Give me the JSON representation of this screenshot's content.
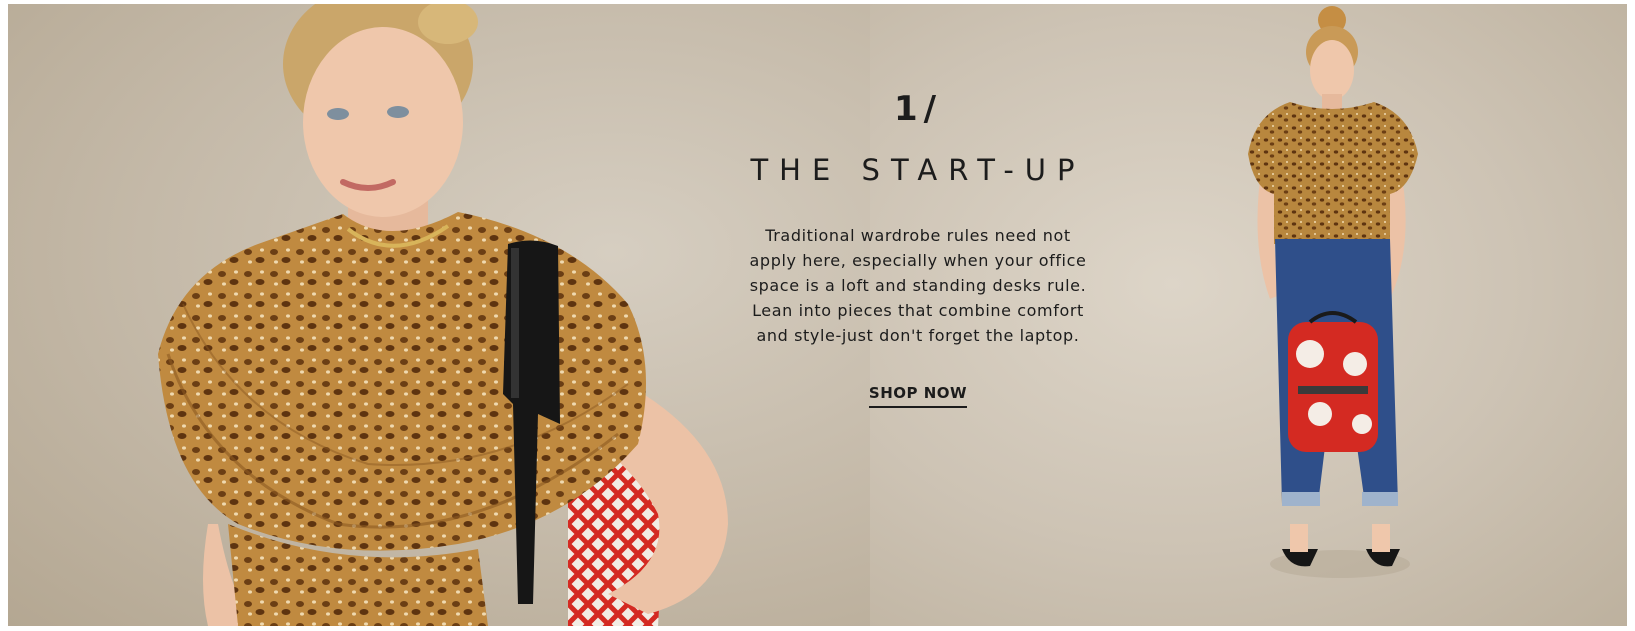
{
  "promo": {
    "number": "1/",
    "title": "THE START-UP",
    "description": "Traditional wardrobe rules need not apply here, especially when your office space is a loft and standing desks rule. Lean into pieces that combine comfort and style-just don't forget the laptop.",
    "cta_label": "SHOP NOW"
  },
  "colors": {
    "text": "#1c1c1c",
    "background_left": "#c4b9a8",
    "background_right": "#cdc3b4",
    "leopard_base": "#b5823a",
    "denim": "#2f4f8a",
    "backpack_red": "#d42a22"
  }
}
